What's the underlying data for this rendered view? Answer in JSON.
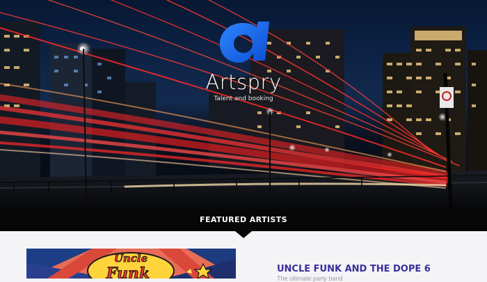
{
  "brand": {
    "name": "Artspry",
    "tagline": "Talent and booking"
  },
  "featured": {
    "heading": "FEATURED ARTISTS",
    "artists": [
      {
        "name": "UNCLE FUNK AND THE DOPE 6",
        "description": "The ultimate party band",
        "image_text": "Uncle Funk"
      }
    ]
  },
  "colors": {
    "brand_blue": "#1565e6",
    "band_black": "#070707",
    "artist_title": "#3b2e9c"
  }
}
